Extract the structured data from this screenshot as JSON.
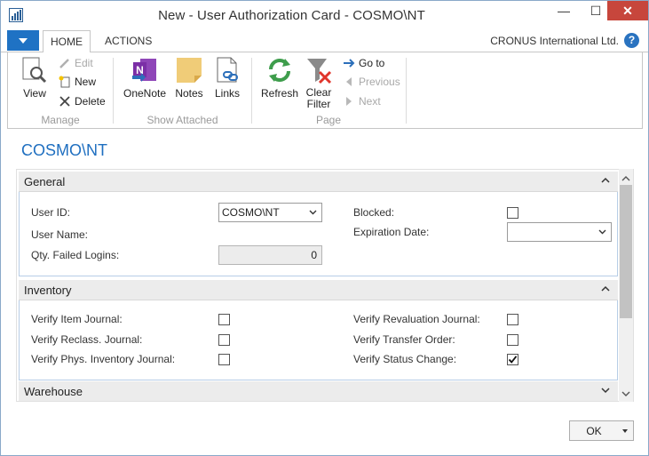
{
  "window": {
    "title": "New - User Authorization Card - COSMO\\NT",
    "min_symbol": "—",
    "max_symbol": "☐",
    "close_symbol": "✕"
  },
  "ribbon": {
    "tabs": [
      "HOME",
      "ACTIONS"
    ],
    "company": "CRONUS International Ltd.",
    "help": "?",
    "groups": {
      "manage": {
        "label": "Manage",
        "view": "View",
        "edit": "Edit",
        "new": "New",
        "delete": "Delete"
      },
      "show_attached": {
        "label": "Show Attached",
        "onenote": "OneNote",
        "notes": "Notes",
        "links": "Links"
      },
      "page": {
        "label": "Page",
        "refresh": "Refresh",
        "clear_filter_line1": "Clear",
        "clear_filter_line2": "Filter",
        "goto": "Go to",
        "previous": "Previous",
        "next": "Next"
      }
    }
  },
  "page": {
    "title": "COSMO\\NT"
  },
  "general": {
    "header": "General",
    "user_id_label": "User ID:",
    "user_id_value": "COSMO\\NT",
    "user_name_label": "User Name:",
    "failed_logins_label": "Qty. Failed Logins:",
    "failed_logins_value": "0",
    "blocked_label": "Blocked:",
    "blocked": false,
    "expiration_label": "Expiration Date:",
    "expiration_value": ""
  },
  "inventory": {
    "header": "Inventory",
    "items": [
      {
        "label": "Verify Item Journal:",
        "checked": false
      },
      {
        "label": "Verify Reclass. Journal:",
        "checked": false
      },
      {
        "label": "Verify Phys. Inventory Journal:",
        "checked": false
      },
      {
        "label": "Verify Revaluation Journal:",
        "checked": false
      },
      {
        "label": "Verify Transfer Order:",
        "checked": false
      },
      {
        "label": "Verify Status Change:",
        "checked": true
      }
    ]
  },
  "warehouse": {
    "header": "Warehouse"
  },
  "footer": {
    "ok_label": "OK"
  }
}
